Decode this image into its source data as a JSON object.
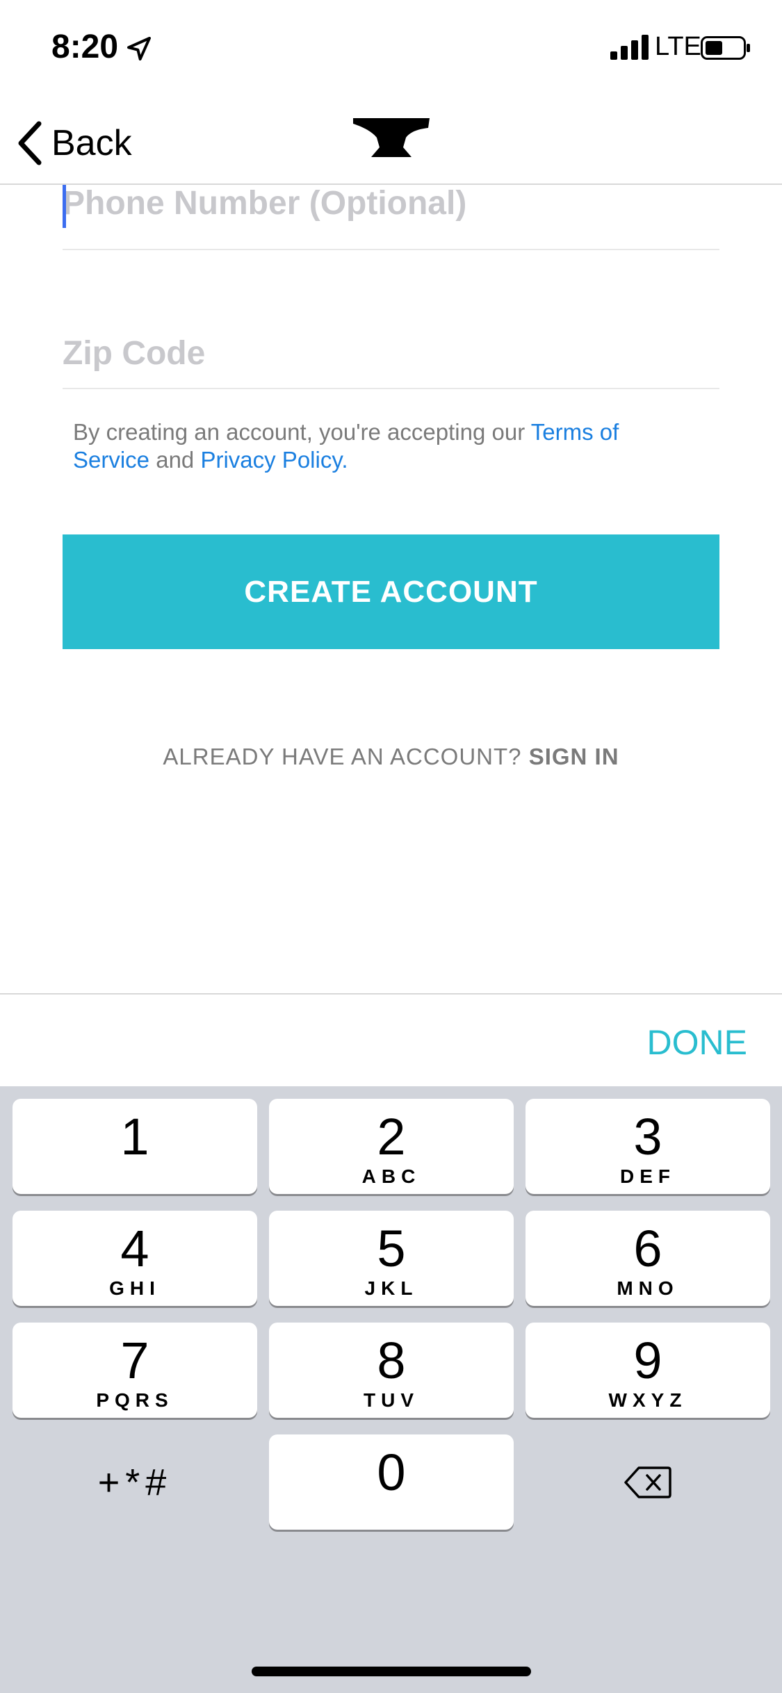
{
  "status_bar": {
    "time": "8:20",
    "network": "LTE",
    "icons": [
      "location-arrow-icon",
      "cellular-signal-icon",
      "battery-icon"
    ]
  },
  "nav": {
    "back_label": "Back",
    "logo_icon": "anvil-logo-icon"
  },
  "form": {
    "phone_placeholder": "Phone Number (Optional)",
    "zip_placeholder": "Zip Code",
    "terms_prefix": "By creating an account, you're accepting our ",
    "terms_link": "Terms of Service",
    "terms_middle": " and ",
    "privacy_link": "Privacy Policy",
    "terms_suffix": ".",
    "create_button": "CREATE ACCOUNT",
    "signin_prompt": "ALREADY HAVE AN ACCOUNT? ",
    "signin_link": "SIGN IN"
  },
  "accessory": {
    "done_label": "DONE"
  },
  "keyboard": {
    "keys": [
      {
        "num": "1",
        "letters": ""
      },
      {
        "num": "2",
        "letters": "ABC"
      },
      {
        "num": "3",
        "letters": "DEF"
      },
      {
        "num": "4",
        "letters": "GHI"
      },
      {
        "num": "5",
        "letters": "JKL"
      },
      {
        "num": "6",
        "letters": "MNO"
      },
      {
        "num": "7",
        "letters": "PQRS"
      },
      {
        "num": "8",
        "letters": "TUV"
      },
      {
        "num": "9",
        "letters": "WXYZ"
      },
      {
        "num": "0",
        "letters": ""
      }
    ],
    "symbols_label": "+*#",
    "delete_icon": "backspace-icon"
  },
  "colors": {
    "accent": "#29bdcf",
    "link": "#1a7fe0",
    "keyboard_bg": "#d1d4db"
  }
}
